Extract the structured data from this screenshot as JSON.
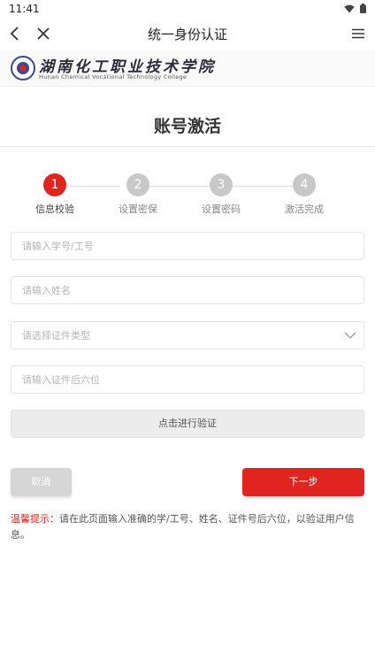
{
  "status_bar": {
    "time": "11:41"
  },
  "nav": {
    "title": "统一身份认证"
  },
  "logo": {
    "cn": "湖南化工职业技术学院",
    "en": "Hunan Chemical Vocational Technology College"
  },
  "page": {
    "heading": "账号激活"
  },
  "steps": [
    {
      "number": "1",
      "label": "信息校验"
    },
    {
      "number": "2",
      "label": "设置密保"
    },
    {
      "number": "3",
      "label": "设置密码"
    },
    {
      "number": "4",
      "label": "激活完成"
    }
  ],
  "form": {
    "id_placeholder": "请输入学号/工号",
    "name_placeholder": "请输入姓名",
    "cert_type_placeholder": "请选择证件类型",
    "cert_last6_placeholder": "请输入证件后六位",
    "verify_label": "点击进行验证"
  },
  "actions": {
    "cancel_label": "取消",
    "next_label": "下一步"
  },
  "tip": {
    "label": "温馨提示：",
    "text": "请在此页面输入准确的学/工号、姓名、证件号后六位，以验证用户信息。"
  },
  "colors": {
    "accent": "#e02420",
    "inactive_step": "#c8c8c8"
  },
  "icons": [
    "wifi-icon",
    "battery-icon",
    "back-arrow-icon",
    "close-icon",
    "menu-icon",
    "chevron-down-icon",
    "college-emblem-icon"
  ]
}
